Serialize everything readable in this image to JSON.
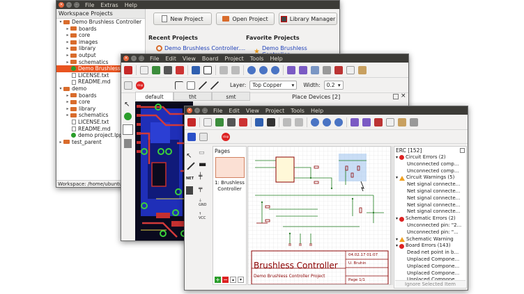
{
  "workspace": {
    "menu": [
      "File",
      "Extras",
      "Help"
    ],
    "tree_header": "Workspace Projects",
    "tree": [
      {
        "label": "Demo Brushless Controller",
        "indent": 0,
        "type": "folder",
        "expanded": true
      },
      {
        "label": "boards",
        "indent": 1,
        "type": "folder"
      },
      {
        "label": "core",
        "indent": 1,
        "type": "folder"
      },
      {
        "label": "images",
        "indent": 1,
        "type": "folder"
      },
      {
        "label": "library",
        "indent": 1,
        "type": "folder"
      },
      {
        "label": "output",
        "indent": 1,
        "type": "folder"
      },
      {
        "label": "schematics",
        "indent": 1,
        "type": "folder"
      },
      {
        "label": "Demo Brushless",
        "indent": 1,
        "type": "project",
        "selected": true
      },
      {
        "label": "LICENSE.txt",
        "indent": 1,
        "type": "file"
      },
      {
        "label": "README.md",
        "indent": 1,
        "type": "file"
      },
      {
        "label": "demo",
        "indent": 0,
        "type": "folder",
        "expanded": true
      },
      {
        "label": "boards",
        "indent": 1,
        "type": "folder"
      },
      {
        "label": "core",
        "indent": 1,
        "type": "folder"
      },
      {
        "label": "library",
        "indent": 1,
        "type": "folder"
      },
      {
        "label": "schematics",
        "indent": 1,
        "type": "folder"
      },
      {
        "label": "LICENSE.txt",
        "indent": 1,
        "type": "file"
      },
      {
        "label": "README.md",
        "indent": 1,
        "type": "file"
      },
      {
        "label": "demo project.lpp",
        "indent": 1,
        "type": "project"
      },
      {
        "label": "test_parent",
        "indent": 0,
        "type": "folder",
        "expanded": false
      }
    ],
    "status": "Workspace: /home/ubuntu",
    "buttons": {
      "new_project": "New Project",
      "open_project": "Open Project",
      "library_manager": "Library Manager"
    },
    "recent_heading": "Recent Projects",
    "favorite_heading": "Favorite Projects",
    "recent_item": "Demo Brushless Controller....",
    "favorite_item": "Demo Brushless Controller...."
  },
  "board_editor": {
    "menu": [
      "File",
      "Edit",
      "View",
      "Board",
      "Project",
      "Tools",
      "Help"
    ],
    "layer_label": "Layer:",
    "layer_value": "Top Copper",
    "width_label": "Width:",
    "width_value": "0.2",
    "tabs": [
      "default",
      "tht",
      "smt"
    ],
    "place_devices": "Place Devices [2]"
  },
  "schematic_editor": {
    "menu": [
      "File",
      "Edit",
      "View",
      "Project",
      "Tools",
      "Help"
    ],
    "pages_label": "Pages",
    "page_item": "1: Brushless Controller",
    "sheet_title": "Brushless Controller",
    "sheet_subtitle": "Demo Brushless Controller Project",
    "sheet_date": "04.02.17 01:07",
    "sheet_author": "U. Bruhin",
    "sheet_page": "Page 1/1",
    "erc_title": "ERC [152]",
    "erc_rows": [
      {
        "kind": "cat",
        "icon": "error",
        "text": "Circuit Errors (2)"
      },
      {
        "kind": "item",
        "text": "Unconnected comp..."
      },
      {
        "kind": "item",
        "text": "Unconnected comp..."
      },
      {
        "kind": "cat",
        "icon": "warning",
        "text": "Circuit Warnings (5)"
      },
      {
        "kind": "item",
        "text": "Net signal connecte..."
      },
      {
        "kind": "item",
        "text": "Net signal connecte..."
      },
      {
        "kind": "item",
        "text": "Net signal connecte..."
      },
      {
        "kind": "item",
        "text": "Net signal connecte..."
      },
      {
        "kind": "item",
        "text": "Net signal connecte..."
      },
      {
        "kind": "cat",
        "icon": "error",
        "text": "Schematic Errors (2)"
      },
      {
        "kind": "item",
        "text": "Unconnected pin: \"2..."
      },
      {
        "kind": "item",
        "text": "Unconnected pin: \"..."
      },
      {
        "kind": "cat",
        "icon": "warning",
        "text": "Schematic Warning"
      },
      {
        "kind": "cat",
        "icon": "error",
        "text": "Board Errors (143)"
      },
      {
        "kind": "item",
        "text": "Dead net point in b..."
      },
      {
        "kind": "item",
        "text": "Unplaced Compone..."
      },
      {
        "kind": "item",
        "text": "Unplaced Compone..."
      },
      {
        "kind": "item",
        "text": "Unplaced Compone..."
      },
      {
        "kind": "item",
        "text": "Unplaced Compone..."
      }
    ],
    "ignore_button": "Ignore Selected Item",
    "symbol_labels": {
      "net": "NET",
      "gnd": "GND",
      "vcc": "VCC"
    }
  },
  "colors": {
    "accent": "#e95420",
    "title_bar": "#3c3b37",
    "link": "#1d3fb8",
    "schematic_frame": "#8b0000"
  }
}
